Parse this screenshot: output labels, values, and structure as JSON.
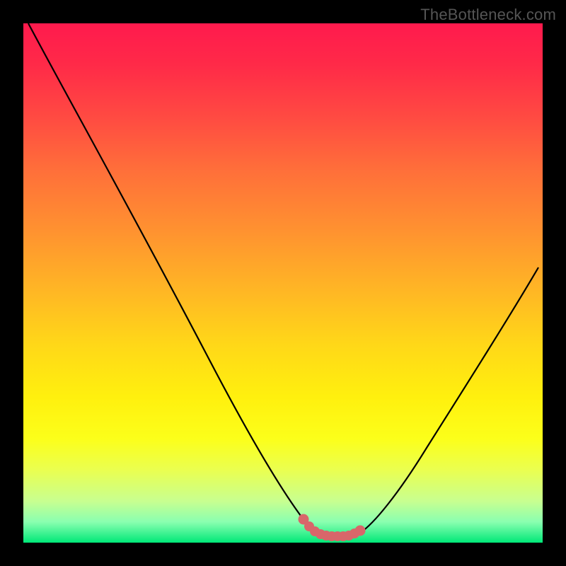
{
  "watermark": "TheBottleneck.com",
  "chart_data": {
    "type": "line",
    "title": "",
    "xlabel": "",
    "ylabel": "",
    "xlim": [
      0,
      100
    ],
    "ylim": [
      0,
      100
    ],
    "series": [
      {
        "name": "main-curve",
        "x": [
          1,
          10,
          20,
          30,
          40,
          48,
          52,
          55,
          57,
          60,
          63,
          66,
          72,
          80,
          90,
          100
        ],
        "y": [
          100,
          82,
          64,
          46,
          28,
          12,
          6,
          3,
          2,
          2,
          2,
          3,
          7,
          18,
          35,
          55
        ]
      },
      {
        "name": "minimum-marker",
        "x": [
          55,
          56,
          57,
          58,
          59,
          60,
          61,
          62,
          63,
          64,
          65
        ],
        "y": [
          3.2,
          2.6,
          2.2,
          2.0,
          1.9,
          1.9,
          1.9,
          2.0,
          2.3,
          2.7,
          3.3
        ]
      }
    ],
    "colors": {
      "curve": "#000000",
      "marker": "#d8666a",
      "gradient_top": "#ff1a4d",
      "gradient_bottom": "#00e878"
    }
  }
}
